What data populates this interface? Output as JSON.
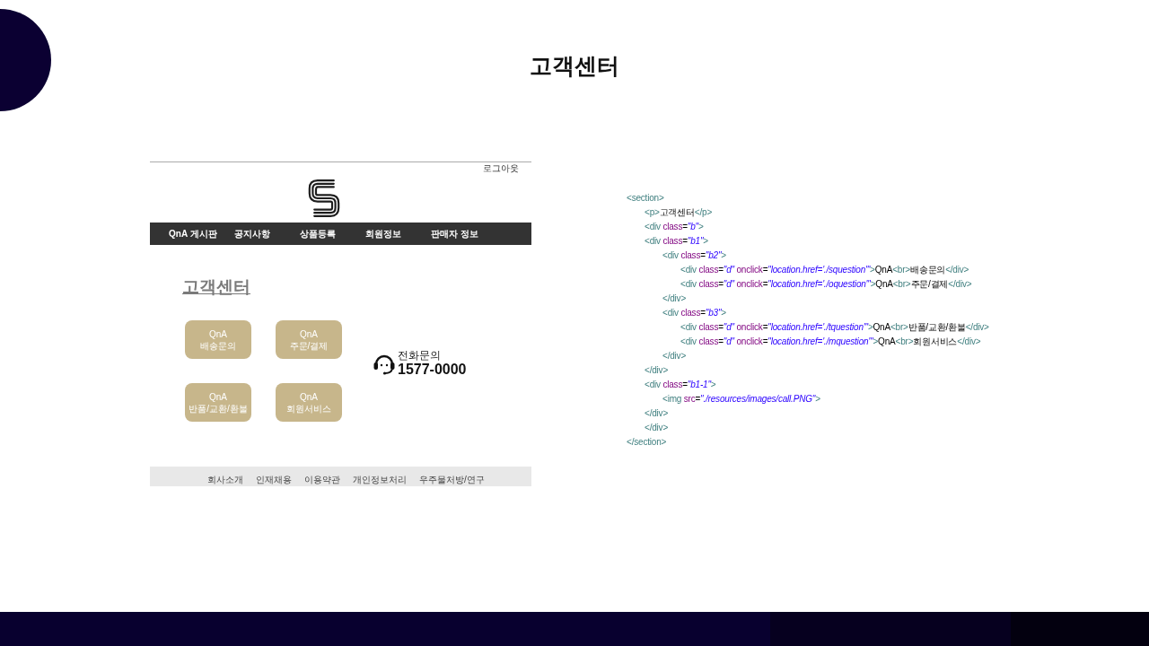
{
  "slide": {
    "title": "고객센터"
  },
  "screenshot": {
    "logout_link": "로그아웃",
    "nav": [
      "QnA 게시판",
      "공지사항",
      "상품등록",
      "회원정보",
      "판매자 정보"
    ],
    "heading": "고객센터",
    "buttons": [
      {
        "lines": [
          "QnA",
          "배송문의"
        ]
      },
      {
        "lines": [
          "QnA",
          "주문/결제"
        ]
      },
      {
        "lines": [
          "QnA",
          "반품/교환/환불"
        ]
      },
      {
        "lines": [
          "QnA",
          "회원서비스"
        ]
      }
    ],
    "phone": {
      "label": "전화문의",
      "number": "1577-0000"
    },
    "footer_links": [
      "회사소개",
      "인재채용",
      "이용약관",
      "개인정보처리",
      "우주물처방/연구"
    ]
  },
  "code": {
    "lines": [
      {
        "tokens": [
          {
            "kind": "tag",
            "text": "<section>"
          }
        ],
        "children": [
          {
            "tokens": [
              {
                "kind": "tag",
                "text": "<p>"
              },
              {
                "kind": "text",
                "text": "고객센터"
              },
              {
                "kind": "tag",
                "text": "</p>"
              }
            ]
          },
          {
            "tokens": [
              {
                "kind": "tag",
                "text": "<div"
              },
              {
                "kind": "attr",
                "text": " class"
              },
              {
                "kind": "text",
                "text": "="
              },
              {
                "kind": "value",
                "text": "\"b\""
              },
              {
                "kind": "tag",
                "text": ">"
              }
            ]
          },
          {
            "tokens": [
              {
                "kind": "tag",
                "text": "<div"
              },
              {
                "kind": "attr",
                "text": " class"
              },
              {
                "kind": "text",
                "text": "="
              },
              {
                "kind": "value",
                "text": "\"b1\""
              },
              {
                "kind": "tag",
                "text": ">"
              }
            ],
            "children": [
              {
                "tokens": [
                  {
                    "kind": "tag",
                    "text": "<div"
                  },
                  {
                    "kind": "attr",
                    "text": " class"
                  },
                  {
                    "kind": "text",
                    "text": "="
                  },
                  {
                    "kind": "value",
                    "text": "\"b2\""
                  },
                  {
                    "kind": "tag",
                    "text": ">"
                  }
                ],
                "children": [
                  {
                    "tokens": [
                      {
                        "kind": "tag",
                        "text": "<div"
                      },
                      {
                        "kind": "attr",
                        "text": " class"
                      },
                      {
                        "kind": "text",
                        "text": "="
                      },
                      {
                        "kind": "value",
                        "text": "\"d\""
                      },
                      {
                        "kind": "attr",
                        "text": " onclick"
                      },
                      {
                        "kind": "text",
                        "text": "="
                      },
                      {
                        "kind": "value",
                        "text": "\"location.href='./squestion'\""
                      },
                      {
                        "kind": "tag",
                        "text": ">"
                      },
                      {
                        "kind": "text",
                        "text": "QnA"
                      },
                      {
                        "kind": "tag",
                        "text": "<br>"
                      },
                      {
                        "kind": "text",
                        "text": "배송문의"
                      },
                      {
                        "kind": "tag",
                        "text": "</div>"
                      }
                    ]
                  },
                  {
                    "tokens": [
                      {
                        "kind": "tag",
                        "text": "<div"
                      },
                      {
                        "kind": "attr",
                        "text": " class"
                      },
                      {
                        "kind": "text",
                        "text": "="
                      },
                      {
                        "kind": "value",
                        "text": "\"d\""
                      },
                      {
                        "kind": "attr",
                        "text": " onclick"
                      },
                      {
                        "kind": "text",
                        "text": "="
                      },
                      {
                        "kind": "value",
                        "text": "\"location.href='./oquestion'\""
                      },
                      {
                        "kind": "tag",
                        "text": ">"
                      },
                      {
                        "kind": "text",
                        "text": "QnA"
                      },
                      {
                        "kind": "tag",
                        "text": "<br>"
                      },
                      {
                        "kind": "text",
                        "text": "주문/결제"
                      },
                      {
                        "kind": "tag",
                        "text": "</div>"
                      }
                    ]
                  }
                ]
              },
              {
                "tokens": [
                  {
                    "kind": "tag",
                    "text": "</div>"
                  }
                ]
              },
              {
                "tokens": [
                  {
                    "kind": "tag",
                    "text": "<div"
                  },
                  {
                    "kind": "attr",
                    "text": " class"
                  },
                  {
                    "kind": "text",
                    "text": "="
                  },
                  {
                    "kind": "value",
                    "text": "\"b3\""
                  },
                  {
                    "kind": "tag",
                    "text": ">"
                  }
                ],
                "children": [
                  {
                    "tokens": [
                      {
                        "kind": "tag",
                        "text": "<div"
                      },
                      {
                        "kind": "attr",
                        "text": " class"
                      },
                      {
                        "kind": "text",
                        "text": "="
                      },
                      {
                        "kind": "value",
                        "text": "\"d\""
                      },
                      {
                        "kind": "attr",
                        "text": " onclick"
                      },
                      {
                        "kind": "text",
                        "text": "="
                      },
                      {
                        "kind": "value",
                        "text": "\"location.href='./tquestion'\""
                      },
                      {
                        "kind": "tag",
                        "text": ">"
                      },
                      {
                        "kind": "text",
                        "text": "QnA"
                      },
                      {
                        "kind": "tag",
                        "text": "<br>"
                      },
                      {
                        "kind": "text",
                        "text": "반품/교환/환불"
                      },
                      {
                        "kind": "tag",
                        "text": "</div>"
                      }
                    ]
                  },
                  {
                    "tokens": [
                      {
                        "kind": "tag",
                        "text": "<div"
                      },
                      {
                        "kind": "attr",
                        "text": " class"
                      },
                      {
                        "kind": "text",
                        "text": "="
                      },
                      {
                        "kind": "value",
                        "text": "\"d\""
                      },
                      {
                        "kind": "attr",
                        "text": " onclick"
                      },
                      {
                        "kind": "text",
                        "text": "="
                      },
                      {
                        "kind": "value",
                        "text": "\"location.href='./mquestion'\""
                      },
                      {
                        "kind": "tag",
                        "text": ">"
                      },
                      {
                        "kind": "text",
                        "text": "QnA"
                      },
                      {
                        "kind": "tag",
                        "text": "<br>"
                      },
                      {
                        "kind": "text",
                        "text": "회원서비스"
                      },
                      {
                        "kind": "tag",
                        "text": "</div>"
                      }
                    ]
                  }
                ]
              },
              {
                "tokens": [
                  {
                    "kind": "tag",
                    "text": "</div>"
                  }
                ]
              }
            ]
          },
          {
            "tokens": [
              {
                "kind": "tag",
                "text": "</div>"
              }
            ]
          },
          {
            "tokens": [
              {
                "kind": "tag",
                "text": "<div"
              },
              {
                "kind": "attr",
                "text": " class"
              },
              {
                "kind": "text",
                "text": "="
              },
              {
                "kind": "value",
                "text": "\"b1-1\""
              },
              {
                "kind": "tag",
                "text": ">"
              }
            ],
            "children": [
              {
                "tokens": [
                  {
                    "kind": "tag",
                    "text": "<img"
                  },
                  {
                    "kind": "attr",
                    "text": " src"
                  },
                  {
                    "kind": "text",
                    "text": "="
                  },
                  {
                    "kind": "value",
                    "text": "\"./resources/images/call.PNG\""
                  },
                  {
                    "kind": "tag",
                    "text": ">"
                  }
                ]
              }
            ]
          },
          {
            "tokens": [
              {
                "kind": "tag",
                "text": "</div>"
              }
            ]
          },
          {
            "tokens": [
              {
                "kind": "tag",
                "text": "</div>"
              }
            ]
          }
        ]
      },
      {
        "tokens": [
          {
            "kind": "tag",
            "text": "</section>"
          }
        ]
      }
    ]
  }
}
